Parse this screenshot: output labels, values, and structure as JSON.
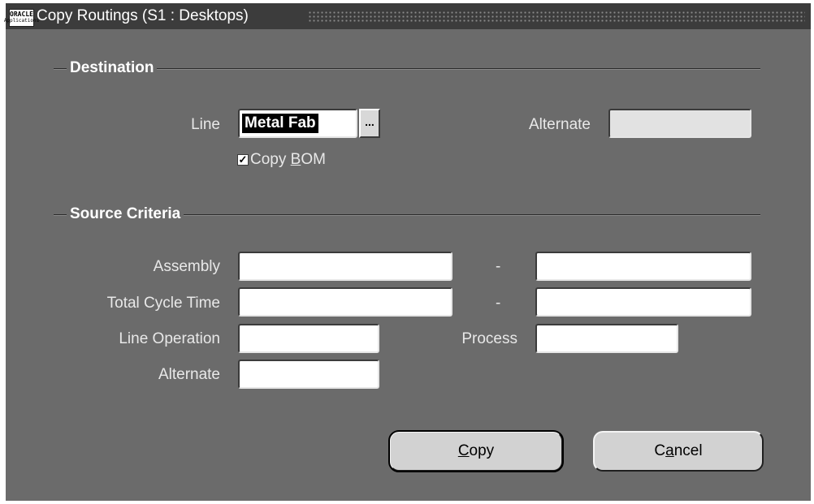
{
  "window": {
    "title": "Copy Routings (S1 : Desktops)",
    "icon_line1": "ORACLE",
    "icon_line2": "Applications"
  },
  "destination": {
    "group_title": "Destination",
    "line_label": "Line",
    "line_value": "Metal Fab",
    "lov_button_label": "...",
    "alternate_label": "Alternate",
    "alternate_value": "",
    "copy_bom_label_pre": "Copy ",
    "copy_bom_label_mnemonic": "B",
    "copy_bom_label_post": "OM",
    "copy_bom_checked": true,
    "check_glyph": "✓"
  },
  "source_criteria": {
    "group_title": "Source Criteria",
    "assembly_label": "Assembly",
    "assembly_from": "",
    "assembly_to": "",
    "total_cycle_time_label": "Total Cycle Time",
    "cycle_from": "",
    "cycle_to": "",
    "range_dash": "-",
    "line_operation_label": "Line Operation",
    "line_operation_value": "",
    "process_label": "Process",
    "process_value": "",
    "alternate_label": "Alternate",
    "alternate_value": ""
  },
  "buttons": {
    "copy_mnemonic": "C",
    "copy_rest": "opy",
    "cancel_pre": "C",
    "cancel_mnemonic": "a",
    "cancel_post": "ncel"
  },
  "colors": {
    "background": "#6b6b6b",
    "titlebar": "#3c3c3c",
    "label_text": "#e8e8e8",
    "field_bg": "#ffffff"
  }
}
